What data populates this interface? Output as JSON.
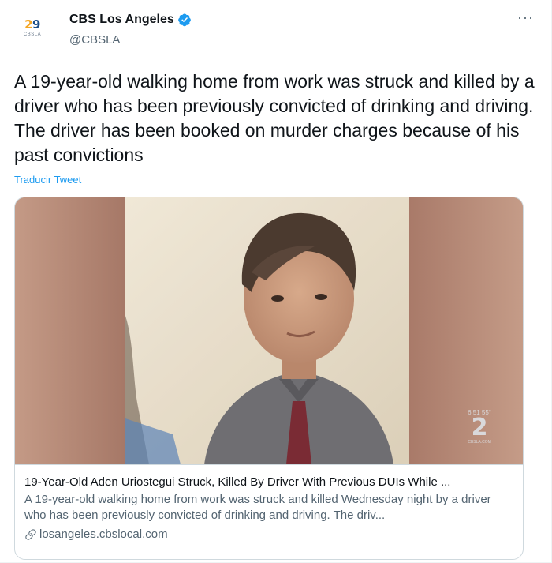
{
  "author": {
    "display_name": "CBS Los Angeles",
    "handle": "@CBSLA",
    "avatar_logo": "2",
    "avatar_logo_left": "",
    "avatar_logo_right": "9",
    "avatar_logo_sub": "CBSLA",
    "verified": true,
    "verified_color": "#1d9bf0"
  },
  "menu": {
    "icon": "more-horizontal-icon",
    "glyph": "···"
  },
  "tweet": {
    "text": "A 19-year-old walking home from work was struck and killed by a driver who has been previously convicted of drinking and driving. The driver has been booked on murder charges because of his past convictions",
    "translate_label": "Traducir Tweet"
  },
  "card": {
    "title": "19-Year-Old Aden Uriostegui Struck, Killed By Driver With Previous DUIs While ...",
    "description": "A 19-year-old walking home from work was struck and killed Wednesday night by a driver who has been previously convicted of drinking and driving. The driv...",
    "domain": "losangeles.cbslocal.com",
    "watermark_top": "6:51  55°",
    "watermark_logo": "2",
    "watermark_sub": "CBSLA.COM"
  },
  "colors": {
    "link": "#1d9bf0",
    "secondary_text": "#536471",
    "border": "#cfd9de"
  }
}
